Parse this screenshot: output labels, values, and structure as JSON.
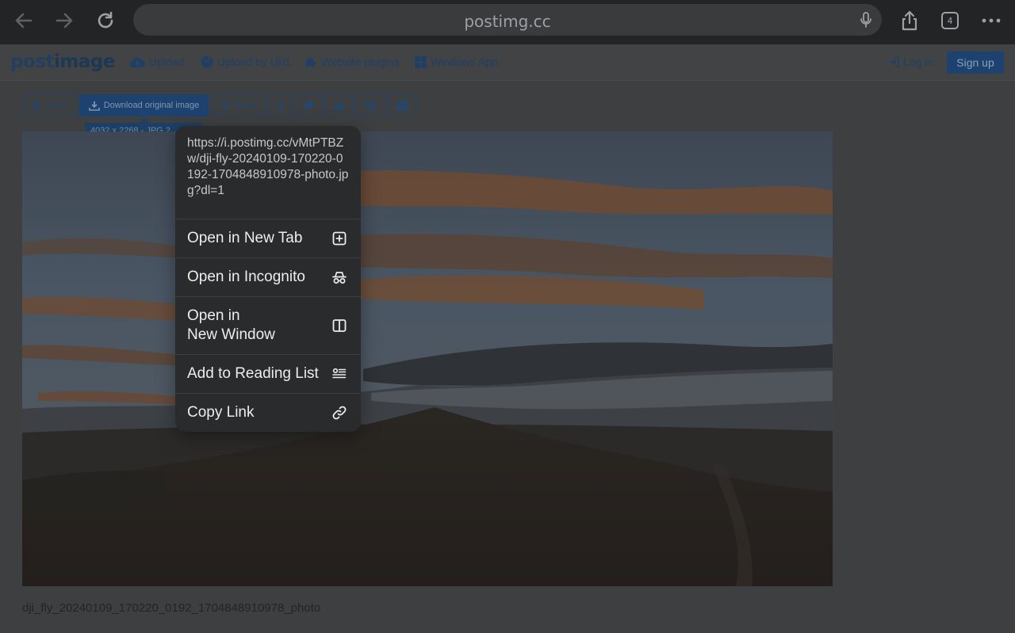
{
  "browser": {
    "url": "postimg.cc",
    "tab_count": "4"
  },
  "site": {
    "logo_post": "post",
    "logo_image": "image",
    "nav": {
      "upload": "Upload",
      "upload_url": "Upload by URL",
      "plugins": "Website plugins",
      "windows_app": "Windows App",
      "login": "Log in",
      "signup": "Sign up"
    }
  },
  "toolbar": {
    "zoom": "Zoom",
    "download": "Download original image",
    "share": "Share",
    "tooltip": "4032 x 2268 - JPG 2.",
    "social_icons": [
      "facebook-icon",
      "twitter-icon",
      "reddit-icon",
      "vk-icon",
      "email-icon"
    ]
  },
  "image": {
    "caption": "dji_fly_20240109_170220_0192_1704848910978_photo"
  },
  "context_menu": {
    "link_url": "https://i.postimg.cc/vMtPTBZw/dji-fly-20240109-170220-0192-1704848910978-photo.jpg?dl=1",
    "items": [
      {
        "label": "Open in New Tab",
        "icon": "plus-square-icon"
      },
      {
        "label": "Open in Incognito",
        "icon": "incognito-icon"
      },
      {
        "label_line1": "Open in",
        "label_line2": "New Window",
        "icon": "split-window-icon"
      },
      {
        "label": "Add to Reading List",
        "icon": "reading-list-icon"
      },
      {
        "label": "Copy Link",
        "icon": "link-icon"
      }
    ]
  },
  "colors": {
    "overlay_bg": "#3d3f40",
    "primary": "#1d4270",
    "menu_bg": "#2a2b2c"
  }
}
